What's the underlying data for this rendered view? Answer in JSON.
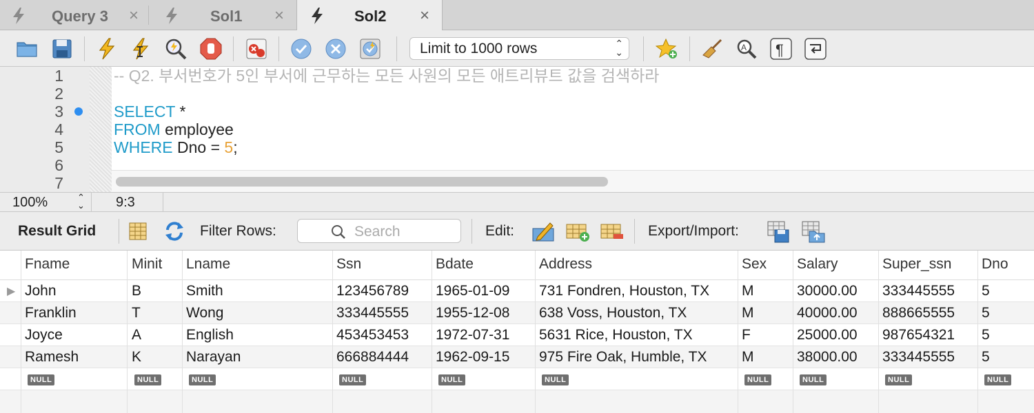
{
  "tabs": [
    {
      "label": "Query 3",
      "close": "×"
    },
    {
      "label": "Sol1",
      "close": "×"
    },
    {
      "label": "Sol2",
      "close": "×"
    }
  ],
  "toolbar": {
    "limit_select": "Limit to 1000 rows"
  },
  "editor": {
    "line_numbers": [
      "1",
      "2",
      "3",
      "4",
      "5",
      "6",
      "7"
    ],
    "comment": "-- Q2. 부서번호가 5인 부서에 근무하는 모든 사원의 모든 애트리뷰트 값을 검색하라",
    "kw_select": "SELECT",
    "select_rest": " *",
    "kw_from": "FROM",
    "from_rest": " employee",
    "kw_where": "WHERE",
    "where_rest": " Dno = ",
    "where_num": "5",
    "where_end": ";"
  },
  "status": {
    "zoom": "100%",
    "cursor": "9:3"
  },
  "result_toolbar": {
    "result_grid": "Result Grid",
    "filter_rows": "Filter Rows:",
    "search_placeholder": "Search",
    "edit": "Edit:",
    "export_import": "Export/Import:"
  },
  "grid": {
    "columns": [
      "Fname",
      "Minit",
      "Lname",
      "Ssn",
      "Bdate",
      "Address",
      "Sex",
      "Salary",
      "Super_ssn",
      "Dno"
    ],
    "rows": [
      [
        "John",
        "B",
        "Smith",
        "123456789",
        "1965-01-09",
        "731 Fondren, Houston, TX",
        "M",
        "30000.00",
        "333445555",
        "5"
      ],
      [
        "Franklin",
        "T",
        "Wong",
        "333445555",
        "1955-12-08",
        "638 Voss, Houston, TX",
        "M",
        "40000.00",
        "888665555",
        "5"
      ],
      [
        "Joyce",
        "A",
        "English",
        "453453453",
        "1972-07-31",
        "5631 Rice, Houston, TX",
        "F",
        "25000.00",
        "987654321",
        "5"
      ],
      [
        "Ramesh",
        "K",
        "Narayan",
        "666884444",
        "1962-09-15",
        "975 Fire Oak, Humble, TX",
        "M",
        "38000.00",
        "333445555",
        "5"
      ]
    ],
    "null_label": "NULL"
  }
}
